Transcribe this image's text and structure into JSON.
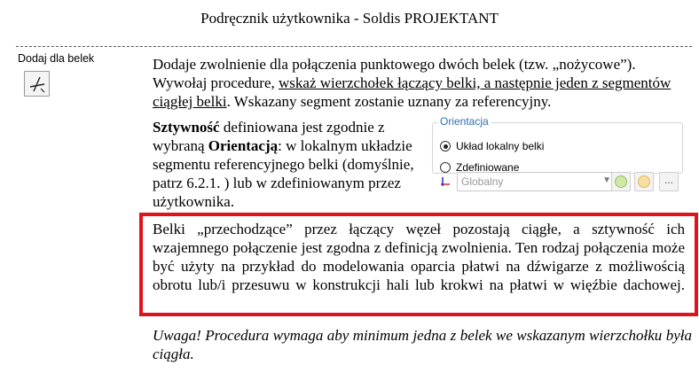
{
  "header": {
    "title": "Podręcznik użytkownika - Soldis PROJEKTANT"
  },
  "sidebar": {
    "label": "Dodaj dla belek",
    "tool_icon": "beam-release-icon"
  },
  "para1": {
    "t1": "Dodaje zwolnienie dla połączenia punktowego dwóch belek (tzw. „nożycowe”). Wywołaj procedure, ",
    "link": "wskaż wierzchołek łączący belki, a następnie jeden z segmentów ciągłej belki",
    "t2": ". Wskazany segment zostanie uznany za referencyjny."
  },
  "para2": {
    "b1": "Sztywność",
    "t1": " definiowana jest zgodnie z wybraną ",
    "b2": "Orientacją",
    "t2": ": w lokalnym układzie segmentu referencyjnego belki (domyślnie, patrz 6.2.1. ) lub w zdefiniowanym przez użytkownika."
  },
  "orientation_panel": {
    "title": "Orientacja",
    "option_local": "Układ lokalny belki",
    "option_defined": "Zdefiniowane",
    "select_value": "Globalny",
    "more_label": "...",
    "colors": {
      "title": "#2f6db5",
      "add_icon": "#98c060",
      "pick_icon": "#e0b860"
    }
  },
  "para3": {
    "text": "Belki „przechodzące” przez łączący węzeł pozostają ciągłe, a sztywność ich wzajemnego połączenie jest zgodna z definicją zwolnienia. Ten rodzaj połączenia może być użyty na przykład do modelowania oparcia płatwi na dźwigarze z możliwością obrotu lub/i przesuwu w konstrukcji hali lub krokwi na płatwi w więźbie dachowej.",
    "highlight_color": "#e0121c"
  },
  "para4": {
    "text": "Uwaga! Procedura wymaga aby minimum jedna z belek we wskazanym wierzchołku była ciągła."
  }
}
